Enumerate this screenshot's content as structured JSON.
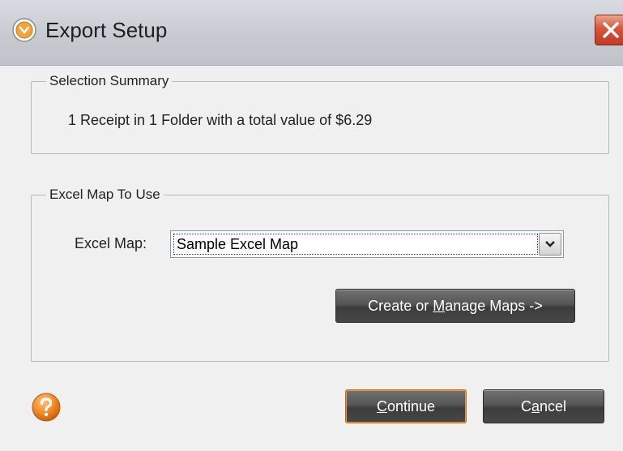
{
  "window": {
    "title": "Export Setup"
  },
  "selection_summary": {
    "legend": "Selection Summary",
    "text": "1 Receipt in 1 Folder with a total value of $6.29"
  },
  "excel_map_group": {
    "legend": "Excel Map To Use",
    "label": "Excel Map:",
    "selected_value": "Sample Excel Map",
    "manage_button": {
      "prefix": "Create or ",
      "mnemonic": "M",
      "suffix": "anage Maps ->"
    }
  },
  "footer": {
    "continue_button": {
      "mnemonic": "C",
      "rest": "ontinue"
    },
    "cancel_button": {
      "prefix": "C",
      "mnemonic": "a",
      "suffix": "ncel"
    }
  },
  "colors": {
    "button_bg": "#555555",
    "default_button_border": "#c46b1a",
    "help_icon": "#f08a24",
    "close_button": "#d6553b"
  },
  "icons": [
    "app-icon",
    "close-icon",
    "dropdown-arrow-icon",
    "help-icon"
  ]
}
